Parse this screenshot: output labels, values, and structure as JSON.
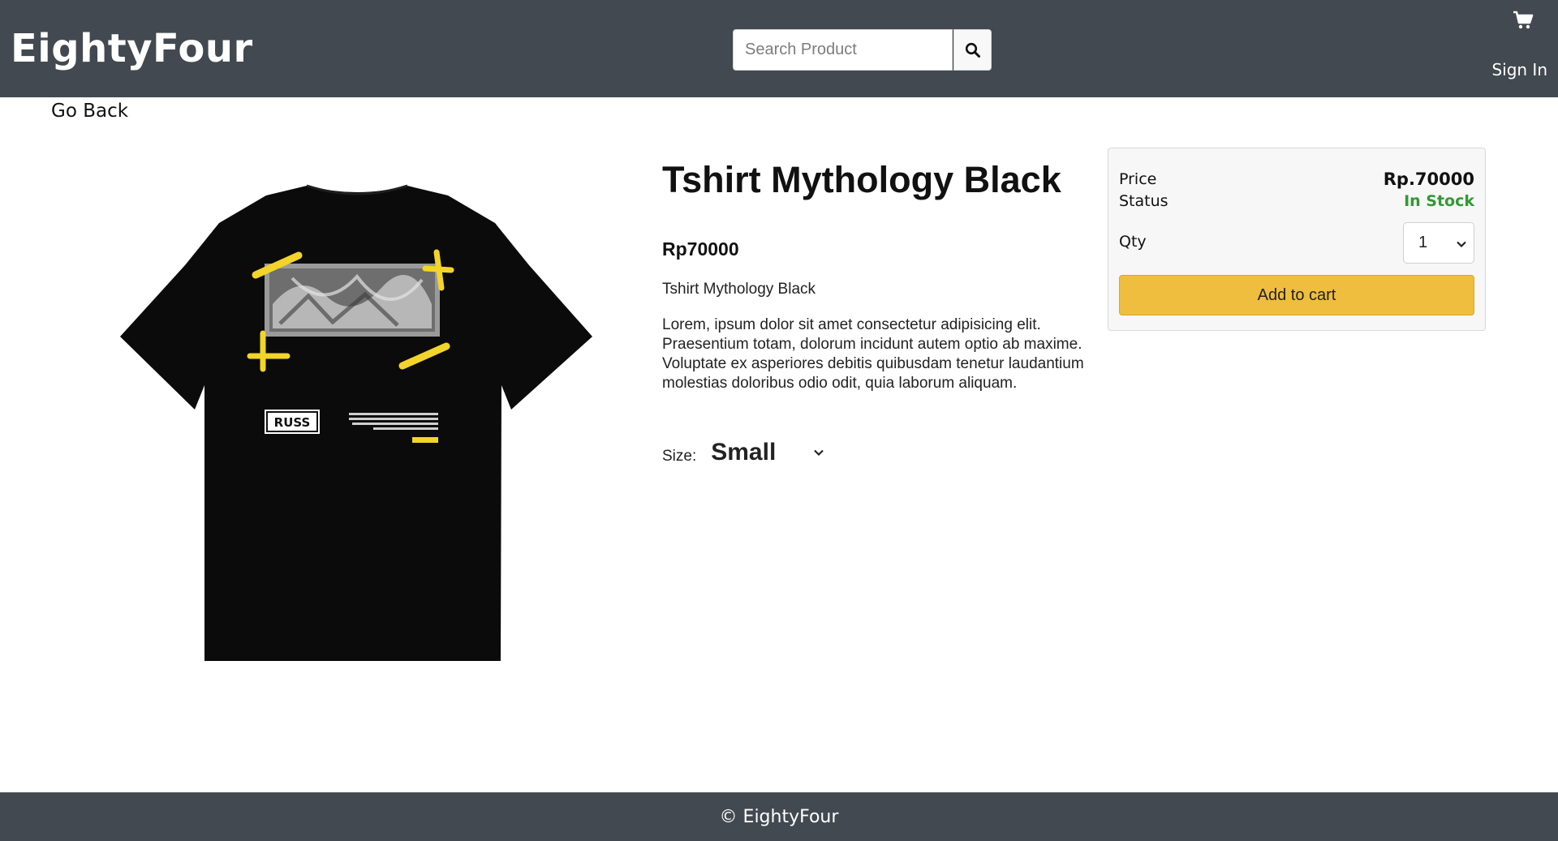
{
  "header": {
    "brand": "EightyFour",
    "search_placeholder": "Search Product",
    "search_icon": "search-icon",
    "cart_icon": "cart-icon",
    "signin_label": "Sign In"
  },
  "nav": {
    "go_back_label": "Go Back"
  },
  "product": {
    "title": "Tshirt Mythology Black",
    "price": "Rp70000",
    "short_description": "Tshirt Mythology Black",
    "description": "Lorem, ipsum dolor sit amet consectetur adipisicing elit. Praesentium totam, dolorum incidunt autem optio ab maxime. Voluptate ex asperiores debitis quibusdam tenetur laudantium molestias doloribus odio odit, quia laborum aliquam.",
    "size_label": "Size:",
    "size_selected": "Small",
    "image_print_text": "RUSS"
  },
  "purchase_card": {
    "price_label": "Price",
    "price_value": "Rp.70000",
    "status_label": "Status",
    "status_value": "In Stock",
    "status_color": "#2f9a34",
    "qty_label": "Qty",
    "qty_selected": "1",
    "add_to_cart_label": "Add to cart",
    "button_color": "#efbe3e"
  },
  "footer": {
    "text": "© EightyFour"
  },
  "colors": {
    "header_bg": "#424950",
    "footer_bg": "#424950"
  }
}
